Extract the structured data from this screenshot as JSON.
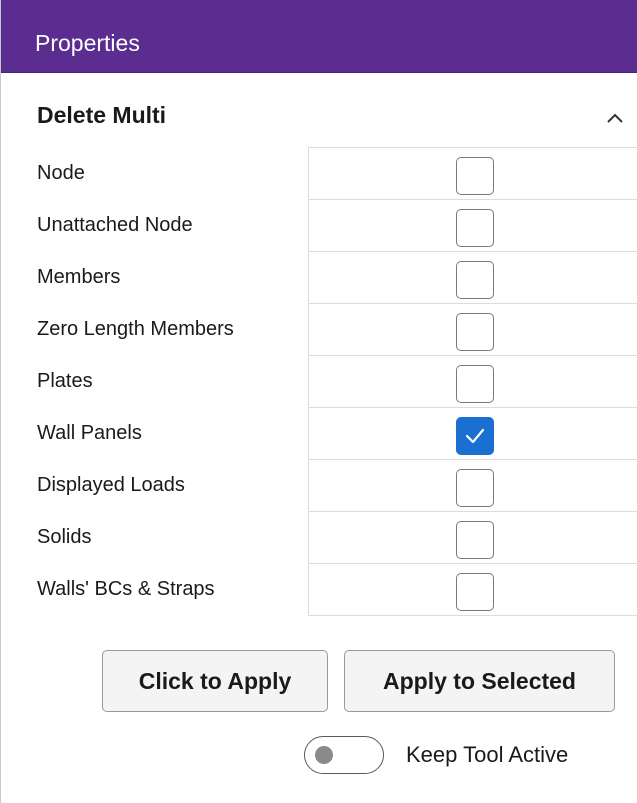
{
  "title_bar": {
    "title": "Properties"
  },
  "section": {
    "title": "Delete Multi",
    "collapse_icon": "chevron-up-icon"
  },
  "rows": [
    {
      "label": "Node",
      "checked": false
    },
    {
      "label": "Unattached Node",
      "checked": false
    },
    {
      "label": "Members",
      "checked": false
    },
    {
      "label": "Zero Length Members",
      "checked": false
    },
    {
      "label": "Plates",
      "checked": false
    },
    {
      "label": "Wall Panels",
      "checked": true
    },
    {
      "label": "Displayed Loads",
      "checked": false
    },
    {
      "label": "Solids",
      "checked": false
    },
    {
      "label": "Walls' BCs & Straps",
      "checked": false
    }
  ],
  "buttons": {
    "click_to_apply": "Click to Apply",
    "apply_to_selected": "Apply to Selected"
  },
  "toggle": {
    "label": "Keep Tool Active",
    "on": false
  },
  "colors": {
    "title_bar": "#5b2d91",
    "checkbox_checked": "#1a6fd1"
  }
}
